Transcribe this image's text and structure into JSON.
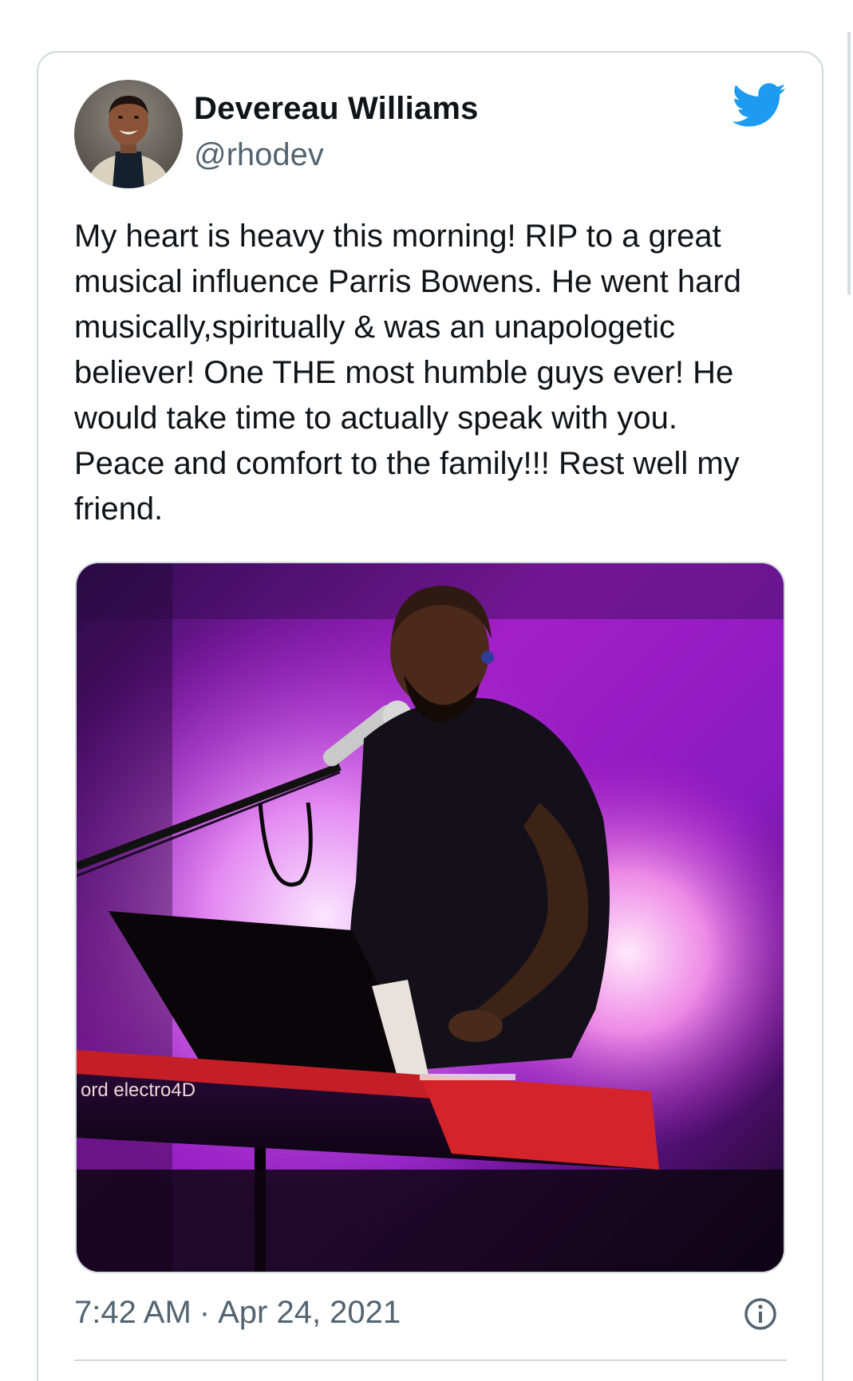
{
  "author": {
    "display_name": "Devereau Williams",
    "handle": "@rhodev",
    "avatar_icon": "profile-photo"
  },
  "brand": {
    "icon": "twitter-bird-icon",
    "color": "#1d9bf0"
  },
  "tweet": {
    "text_lines": [
      "My heart is heavy this morning! RIP to a great",
      "musical influence Parris Bowens. He went hard",
      "musically,spiritually & was an unapologetic",
      "believer! One THE most humble guys ever! He",
      "would take time to actually speak with you.",
      "Peace and comfort to the family!!! Rest well my",
      "friend."
    ],
    "media": {
      "keyboard_brand_text": "ord electro4D"
    },
    "time": "7:42 AM",
    "separator": "·",
    "date": "Apr 24, 2021",
    "info_icon": "info-icon"
  },
  "colors": {
    "text_primary": "#0f1419",
    "text_secondary": "#536471",
    "border": "#cfd9de",
    "keyboard_red": "#d4232a",
    "stage_purple": "#a020c8"
  }
}
